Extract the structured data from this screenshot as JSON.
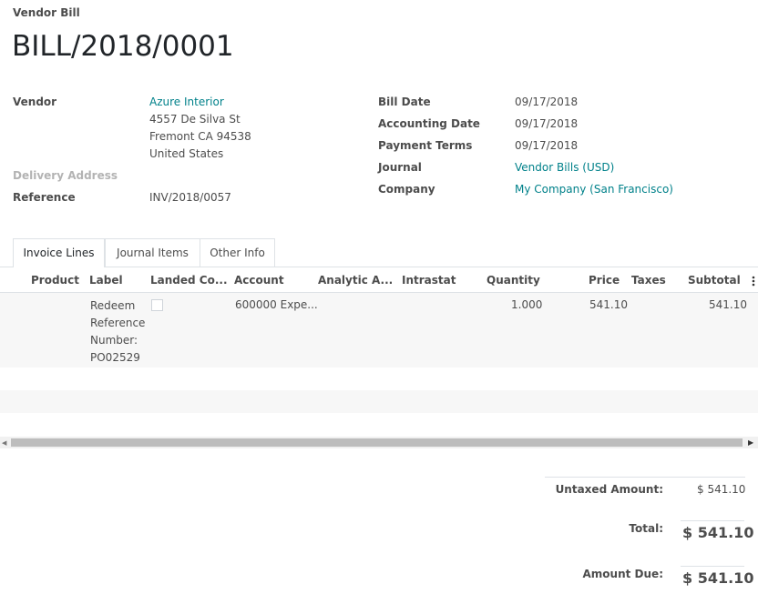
{
  "header": {
    "doc_type": "Vendor Bill",
    "doc_name": "BILL/2018/0001"
  },
  "left_fields": {
    "vendor_label": "Vendor",
    "vendor_name": "Azure Interior",
    "vendor_address": [
      "4557 De Silva St",
      "Fremont CA 94538",
      "United States"
    ],
    "delivery_address_label": "Delivery Address",
    "reference_label": "Reference",
    "reference_value": "INV/2018/0057"
  },
  "right_fields": {
    "bill_date_label": "Bill Date",
    "bill_date_value": "09/17/2018",
    "accounting_date_label": "Accounting Date",
    "accounting_date_value": "09/17/2018",
    "payment_terms_label": "Payment Terms",
    "payment_terms_value": "09/17/2018",
    "journal_label": "Journal",
    "journal_value": "Vendor Bills (USD)",
    "company_label": "Company",
    "company_value": "My Company (San Francisco)"
  },
  "tabs": [
    {
      "label": "Invoice Lines",
      "active": true
    },
    {
      "label": "Journal Items",
      "active": false
    },
    {
      "label": "Other Info",
      "active": false
    }
  ],
  "table": {
    "columns": [
      "Product",
      "Label",
      "Landed Co...",
      "Account",
      "Analytic A...",
      "Intrastat",
      "Quantity",
      "Price",
      "Taxes",
      "Subtotal"
    ],
    "more_icon": "vertical-ellipsis-icon",
    "rows": [
      {
        "product": "",
        "label_lines": [
          "Redeem",
          "Reference",
          "Number:",
          "PO02529"
        ],
        "landed_cost": false,
        "account": "600000 Expe...",
        "analytic": "",
        "intrastat": "",
        "quantity": "1.000",
        "price": "541.10",
        "taxes": "",
        "subtotal": "541.10"
      }
    ]
  },
  "totals": {
    "untaxed_label": "Untaxed Amount:",
    "untaxed_value": "$ 541.10",
    "total_label": "Total:",
    "total_value": "$ 541.10",
    "amount_due_label": "Amount Due:",
    "amount_due_value": "$ 541.10"
  },
  "colors": {
    "link": "#00818a",
    "text": "#4c4c4c",
    "row_bg": "#f7f7f7"
  }
}
